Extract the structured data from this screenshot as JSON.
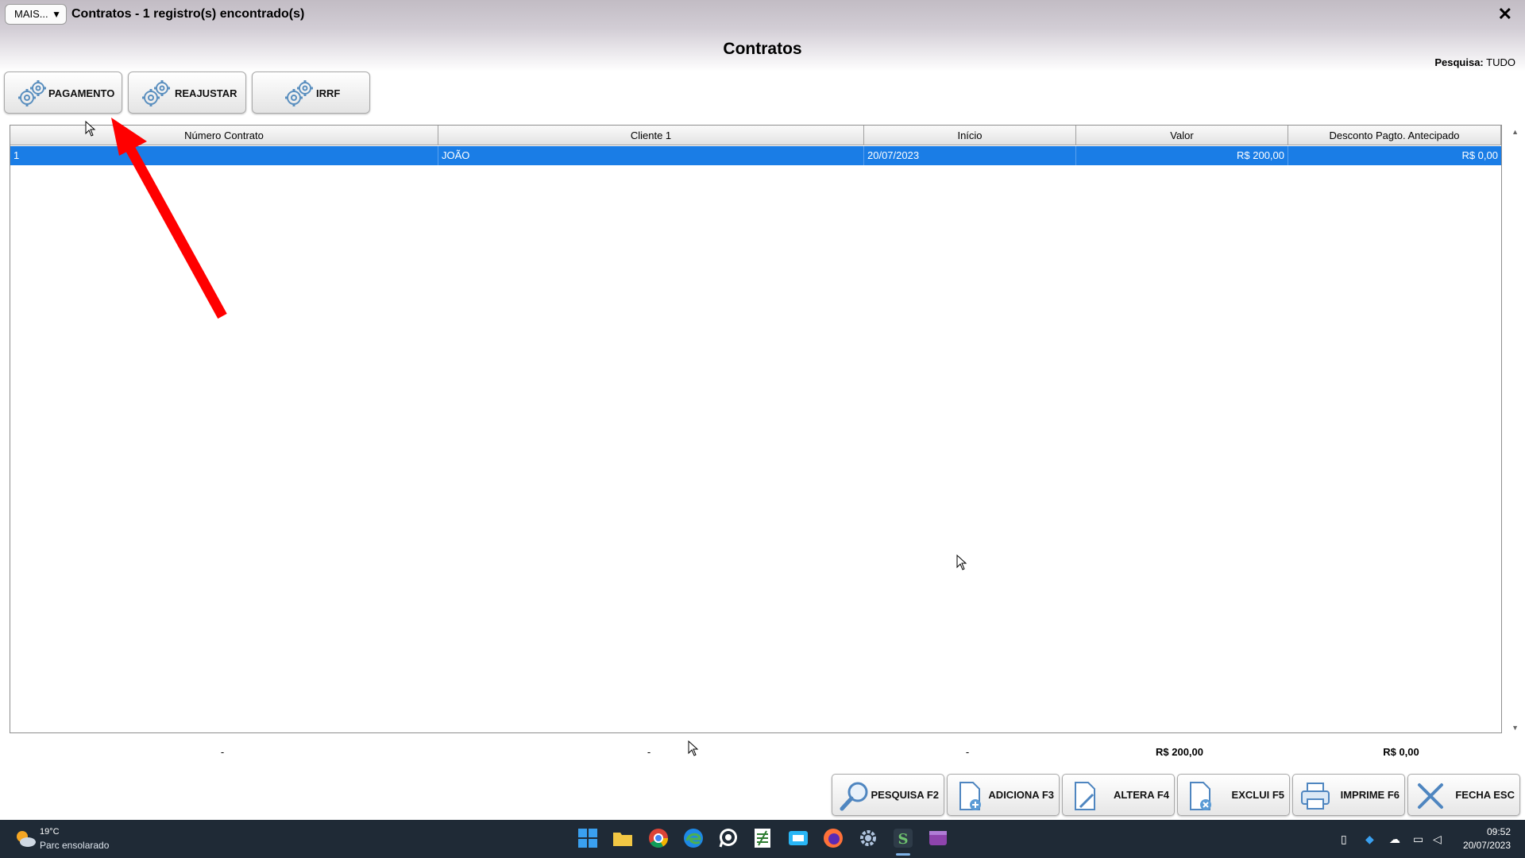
{
  "window": {
    "menu_button": "MAIS...",
    "menu_arrow": "▼",
    "title": "Contratos - 1 registro(s) encontrado(s)",
    "close": "✕"
  },
  "page": {
    "heading": "Contratos",
    "search_label": "Pesquisa:",
    "search_value": "TUDO"
  },
  "actions": [
    {
      "label": "PAGAMENTO",
      "icon": "gear-icon"
    },
    {
      "label": "REAJUSTAR",
      "icon": "gear-icon"
    },
    {
      "label": "IRRF",
      "icon": "gear-icon"
    }
  ],
  "table": {
    "columns": [
      "Número Contrato",
      "Cliente 1",
      "Início",
      "Valor",
      "Desconto Pagto. Antecipado"
    ],
    "rows": [
      [
        "1",
        "JOÃO",
        "20/07/2023",
        "R$ 200,00",
        "R$ 0,00"
      ]
    ],
    "selected_row_color": "#1a7de6"
  },
  "totals": [
    "-",
    "-",
    "-",
    "R$ 200,00",
    "R$ 0,00"
  ],
  "bottom_buttons": [
    {
      "label": "PESQUISA F2",
      "icon": "magnifier-icon"
    },
    {
      "label": "ADICIONA F3",
      "icon": "document-add-icon"
    },
    {
      "label": "ALTERA F4",
      "icon": "document-edit-icon"
    },
    {
      "label": "EXCLUI F5",
      "icon": "document-delete-icon"
    },
    {
      "label": "IMPRIME F6",
      "icon": "printer-icon"
    },
    {
      "label": "FECHA ESC",
      "icon": "close-x-icon"
    }
  ],
  "annotation": {
    "color": "#ff0000",
    "type": "red-arrow-pointing-to-pagamento"
  },
  "taskbar": {
    "weather_temp": "19°C",
    "weather_desc": "Parc ensolarado",
    "apps": [
      "windows-start-icon",
      "file-explorer-icon",
      "chrome-icon",
      "edge-icon",
      "whatsapp-icon",
      "spreadsheet-icon",
      "mail-icon",
      "firefox-icon",
      "settings-icon",
      "app-s-icon",
      "media-icon"
    ],
    "time": "09:52",
    "date": "20/07/2023"
  }
}
